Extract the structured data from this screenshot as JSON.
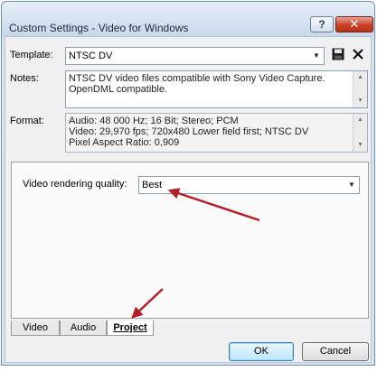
{
  "window": {
    "title": "Custom Settings - Video for Windows",
    "help_label": "?",
    "close_label": "✕"
  },
  "template": {
    "label": "Template:",
    "value": "NTSC DV"
  },
  "notes": {
    "label": "Notes:",
    "lines": [
      "NTSC DV video files compatible with Sony Video Capture.",
      "OpenDML compatible."
    ]
  },
  "format": {
    "label": "Format:",
    "lines": [
      "Audio: 48 000 Hz; 16 Bit; Stereo; PCM",
      "Video: 29,970 fps; 720x480 Lower field first; NTSC DV",
      "Pixel Aspect Ratio: 0,909"
    ]
  },
  "project": {
    "quality_label": "Video rendering quality:",
    "quality_value": "Best"
  },
  "tabs": [
    {
      "label": "Video",
      "active": false
    },
    {
      "label": "Audio",
      "active": false
    },
    {
      "label": "Project",
      "active": true
    }
  ],
  "buttons": {
    "ok": "OK",
    "cancel": "Cancel"
  },
  "icons": {
    "save": "save-icon",
    "delete": "delete-icon"
  },
  "colors": {
    "annotation_arrow": "#b0202a",
    "close_button": "#c7412a"
  }
}
